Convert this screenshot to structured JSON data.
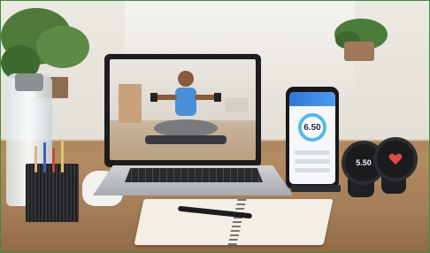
{
  "scene": {
    "phone_metric": "6.50",
    "watch_metric": "5.50",
    "colors": {
      "table_wood": "#a37d57",
      "wall": "#ece9e3",
      "laptop_bezel": "#1d1d1f",
      "phone_accent": "#2f76d6",
      "ring_accent": "#58b8e8"
    }
  }
}
